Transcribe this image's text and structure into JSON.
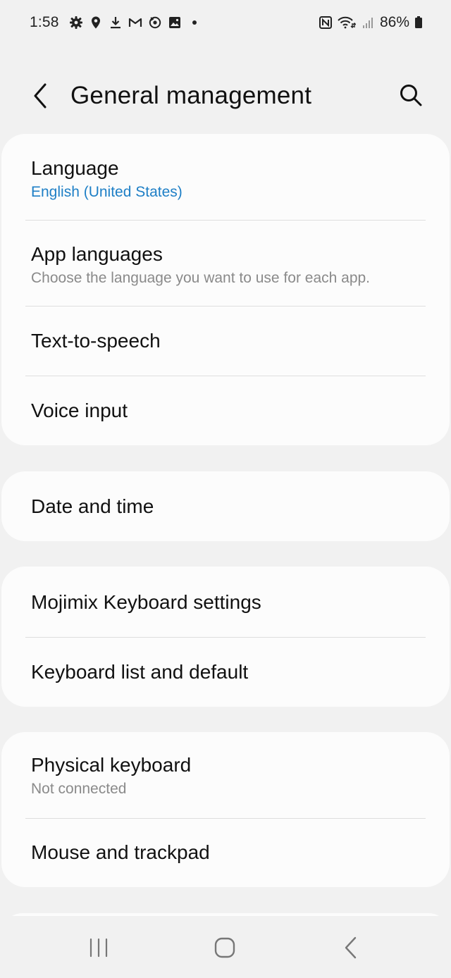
{
  "status_bar": {
    "time": "1:58",
    "left_icons": [
      "settings-icon",
      "location-pin-icon",
      "download-icon",
      "gmail-icon",
      "sync-icon",
      "image-icon",
      "dot-icon"
    ],
    "right_icons": [
      "nfc-icon",
      "wifi-icon",
      "signal-icon",
      "battery-icon"
    ],
    "battery": "86%"
  },
  "header": {
    "title": "General management",
    "back_icon": "chevron-left-icon",
    "search_icon": "search-icon"
  },
  "groups": [
    {
      "items": [
        {
          "title": "Language",
          "subtitle": "English (United States)",
          "subtitle_color": "#1e7fc6"
        },
        {
          "title": "App languages",
          "subtitle": "Choose the language you want to use for each app.",
          "subtitle_color": "#8a8a8a"
        },
        {
          "title": "Text-to-speech"
        },
        {
          "title": "Voice input"
        }
      ]
    },
    {
      "items": [
        {
          "title": "Date and time"
        }
      ]
    },
    {
      "items": [
        {
          "title": "Mojimix Keyboard settings"
        },
        {
          "title": "Keyboard list and default"
        }
      ]
    },
    {
      "items": [
        {
          "title": "Physical keyboard",
          "subtitle": "Not connected",
          "subtitle_color": "#8a8a8a"
        },
        {
          "title": "Mouse and trackpad"
        }
      ]
    }
  ],
  "nav_bar": {
    "recents_icon": "recents-icon",
    "home_icon": "home-icon",
    "back_icon": "back-icon"
  },
  "colors": {
    "background": "#f1f1f1",
    "card": "#fcfcfc",
    "accent": "#1e7fc6",
    "secondary_text": "#8a8a8a"
  }
}
